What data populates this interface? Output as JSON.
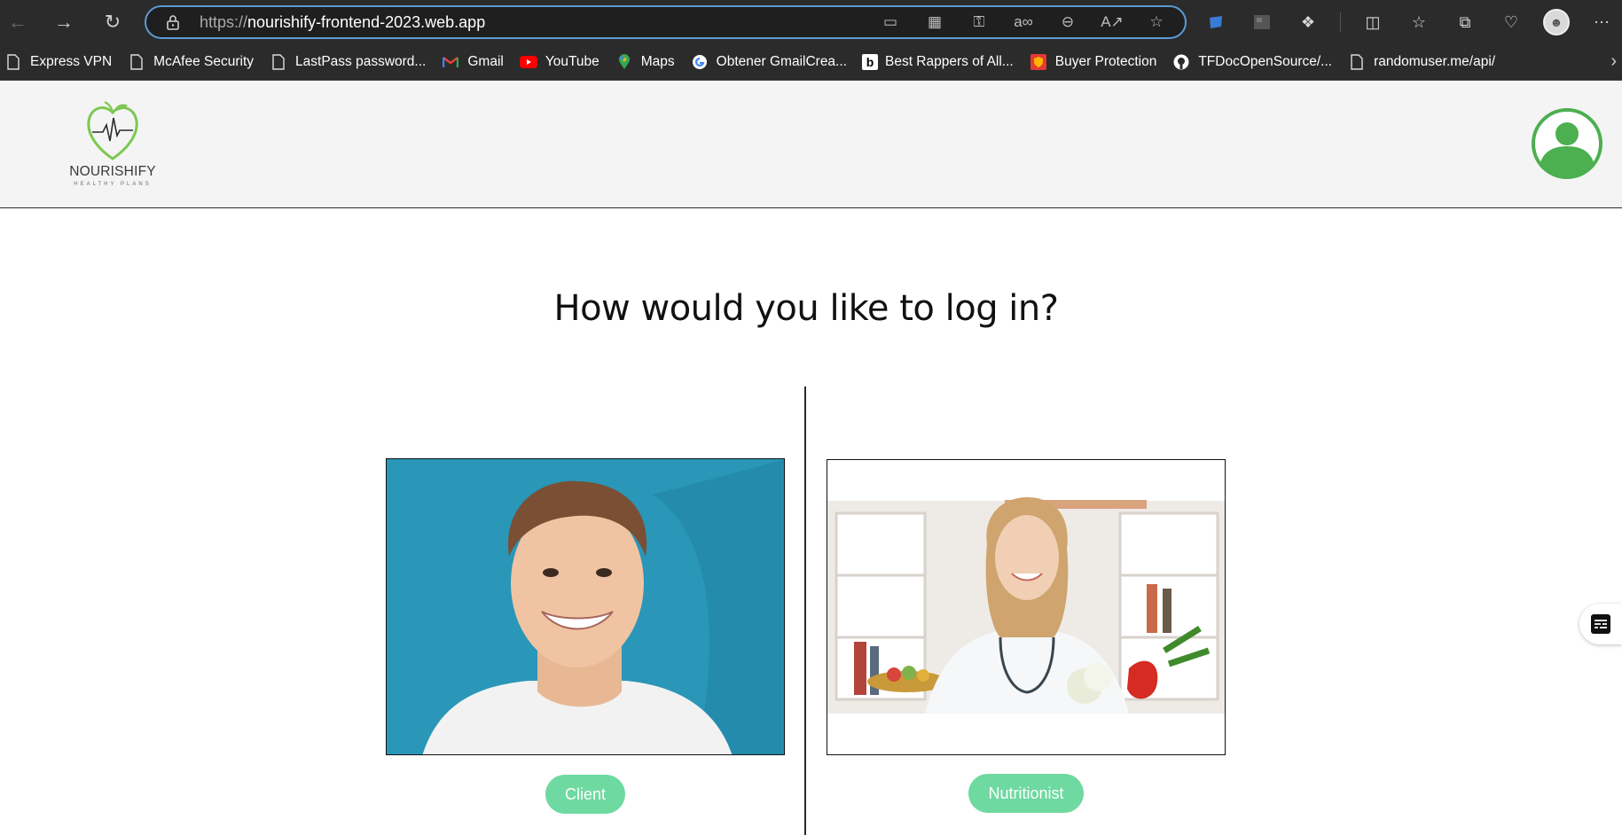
{
  "browser": {
    "url_protocol": "https://",
    "url_host": "nourishify-frontend-2023.web.app",
    "bookmarks": [
      {
        "label": "Express VPN",
        "icon": "page-icon"
      },
      {
        "label": "McAfee Security",
        "icon": "page-icon"
      },
      {
        "label": "LastPass password...",
        "icon": "page-icon"
      },
      {
        "label": "Gmail",
        "icon": "gmail-icon"
      },
      {
        "label": "YouTube",
        "icon": "youtube-icon"
      },
      {
        "label": "Maps",
        "icon": "maps-icon"
      },
      {
        "label": "Obtener GmailCrea...",
        "icon": "google-icon"
      },
      {
        "label": "Best Rappers of All...",
        "icon": "b-icon"
      },
      {
        "label": "Buyer Protection",
        "icon": "shield-icon"
      },
      {
        "label": "TFDocOpenSource/...",
        "icon": "github-icon"
      },
      {
        "label": "randomuser.me/api/",
        "icon": "page-icon"
      }
    ]
  },
  "header": {
    "logo_name": "NOURISHIFY",
    "logo_tagline": "HEALTHY PLANS"
  },
  "main": {
    "title": "How would you like to log in?",
    "client_label": "Client",
    "nutritionist_label": "Nutritionist"
  },
  "colors": {
    "accent_green": "#6ed9a0",
    "profile_green": "#4caf50",
    "address_border": "#5b9bd5"
  }
}
